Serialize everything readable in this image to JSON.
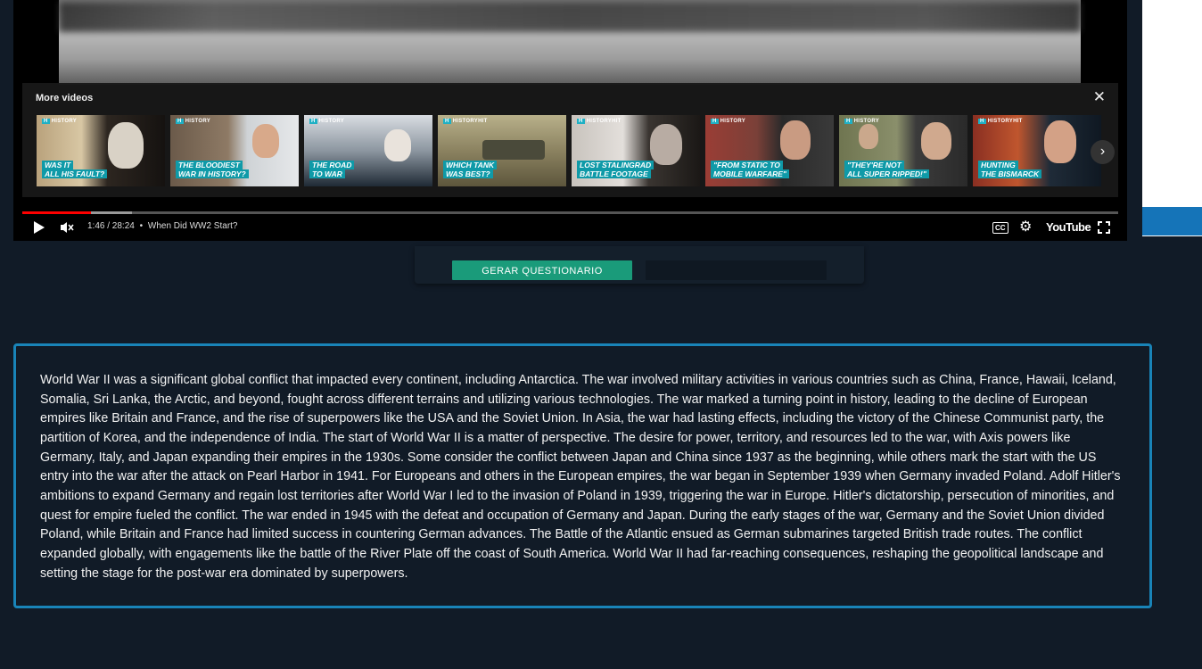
{
  "player": {
    "more_videos_title": "More videos",
    "close_icon": "close-icon",
    "thumbnails": [
      {
        "brand": "HISTORY",
        "caption_1": "WAS IT",
        "caption_2": "ALL HIS FAULT?"
      },
      {
        "brand": "HISTORY",
        "caption_1": "THE BLOODIEST",
        "caption_2": "WAR IN HISTORY?"
      },
      {
        "brand": "HISTORY",
        "caption_1": "THE ROAD",
        "caption_2": "TO WAR"
      },
      {
        "brand": "HISTORYHIT",
        "caption_1": "WHICH TANK",
        "caption_2": "WAS BEST?"
      },
      {
        "brand": "HISTORYHIT",
        "caption_1": "LOST STALINGRAD",
        "caption_2": "BATTLE FOOTAGE"
      },
      {
        "brand": "HISTORY",
        "caption_1": "\"FROM STATIC TO",
        "caption_2": "MOBILE WARFARE\""
      },
      {
        "brand": "HISTORY",
        "caption_1": "\"THEY'RE NOT",
        "caption_2": "ALL SUPER RIPPED!\""
      },
      {
        "brand": "HISTORYHIT",
        "caption_1": "HUNTING",
        "caption_2": "THE BISMARCK"
      }
    ],
    "time": "1:46 / 28:24",
    "separator": "•",
    "video_title": "When Did WW2 Start?",
    "brand_logo": "YouTube",
    "played_fraction": 0.0625
  },
  "actions": {
    "generate_label": "GERAR QUESTIONARIO"
  },
  "summary": {
    "text": "World War II was a significant global conflict that impacted every continent, including Antarctica. The war involved military activities in various countries such as China, France, Hawaii, Iceland, Somalia, Sri Lanka, the Arctic, and beyond, fought across different terrains and utilizing various technologies. The war marked a turning point in history, leading to the decline of European empires like Britain and France, and the rise of superpowers like the USA and the Soviet Union. In Asia, the war had lasting effects, including the victory of the Chinese Communist party, the partition of Korea, and the independence of India. The start of World War II is a matter of perspective. The desire for power, territory, and resources led to the war, with Axis powers like Germany, Italy, and Japan expanding their empires in the 1930s. Some consider the conflict between Japan and China since 1937 as the beginning, while others mark the start with the US entry into the war after the attack on Pearl Harbor in 1941. For Europeans and others in the European empires, the war began in September 1939 when Germany invaded Poland. Adolf Hitler's ambitions to expand Germany and regain lost territories after World War I led to the invasion of Poland in 1939, triggering the war in Europe. Hitler's dictatorship, persecution of minorities, and quest for empire fueled the conflict. The war ended in 1945 with the defeat and occupation of Germany and Japan. During the early stages of the war, Germany and the Soviet Union divided Poland, while Britain and France had limited success in countering German advances. The Battle of the Atlantic ensued as German submarines targeted British trade routes. The conflict expanded globally, with engagements like the battle of the River Plate off the coast of South America. World War II had far-reaching consequences, reshaping the geopolitical landscape and setting the stage for the post-war era dominated by superpowers."
  },
  "colors": {
    "page_bg": "#111b27",
    "accent_border": "#1984b8",
    "generate_button": "#1a9b7a",
    "progress_played": "#ff0000",
    "caption_highlight": "#0f9aa8"
  }
}
